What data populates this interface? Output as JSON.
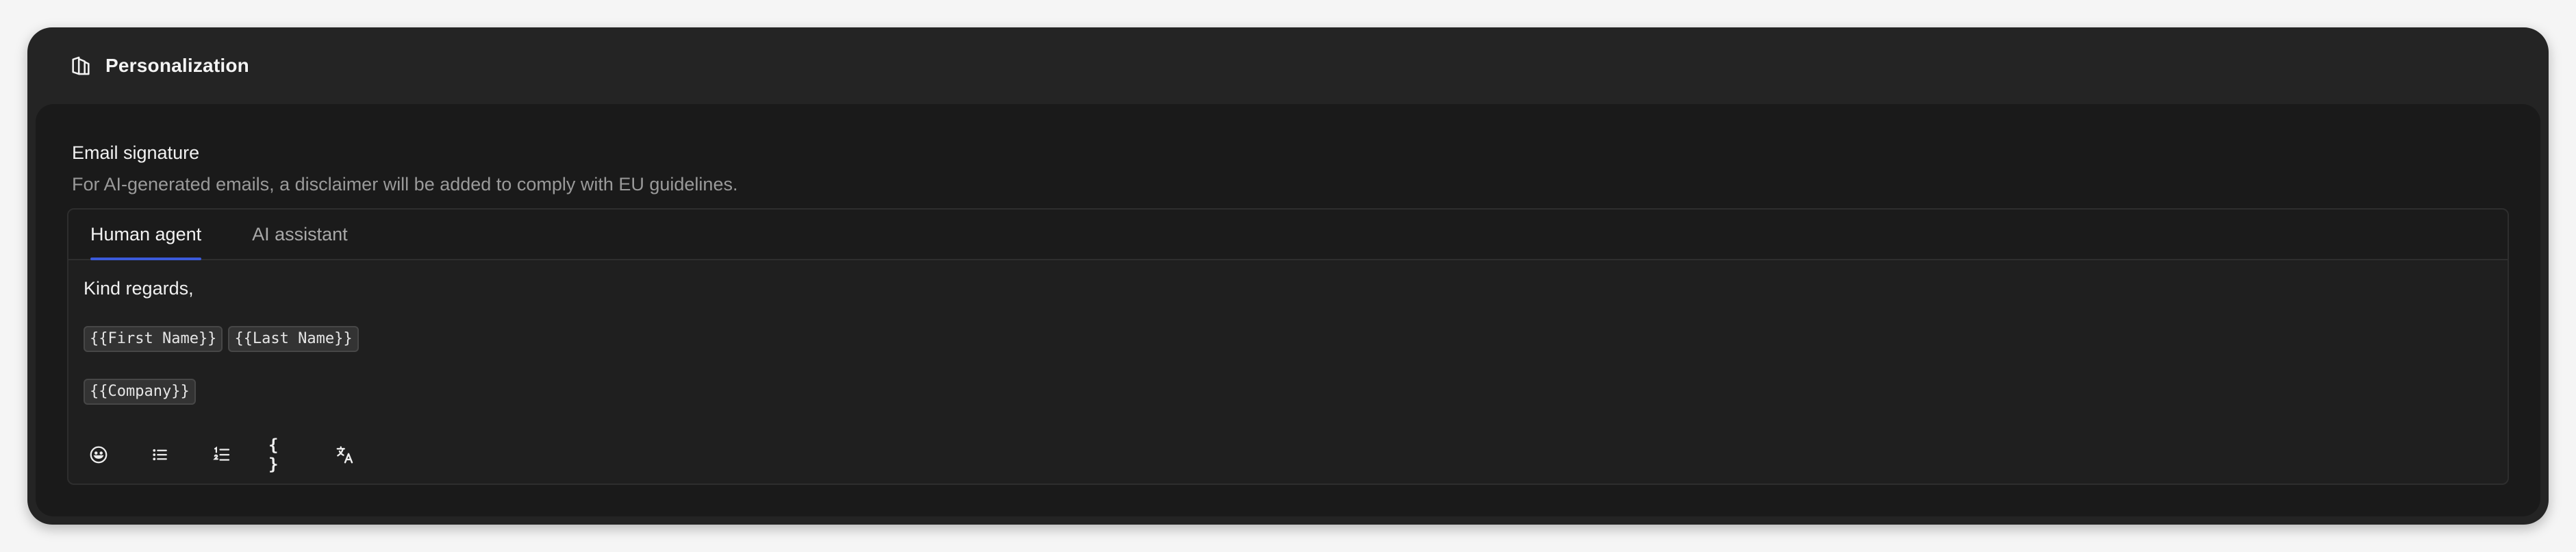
{
  "header": {
    "icon": "personalization-icon",
    "title": "Personalization"
  },
  "signature": {
    "title": "Email signature",
    "description": "For AI-generated emails, a disclaimer will be added to comply with EU guidelines."
  },
  "tabs": [
    {
      "label": "Human agent",
      "active": true
    },
    {
      "label": "AI assistant",
      "active": false
    }
  ],
  "editor": {
    "greeting": "Kind regards,",
    "variables_row1": [
      "{{First Name}}",
      "{{Last Name}}"
    ],
    "variables_row2": [
      "{{Company}}"
    ]
  },
  "toolbar": {
    "items": [
      "emoji-icon",
      "bullet-list-icon",
      "numbered-list-icon",
      "variable-braces-icon",
      "translate-icon"
    ],
    "braces_glyph": "{ }"
  },
  "colors": {
    "accent": "#3b5bdb",
    "card_bg": "#242424",
    "inner_bg": "#1a1a1a"
  }
}
